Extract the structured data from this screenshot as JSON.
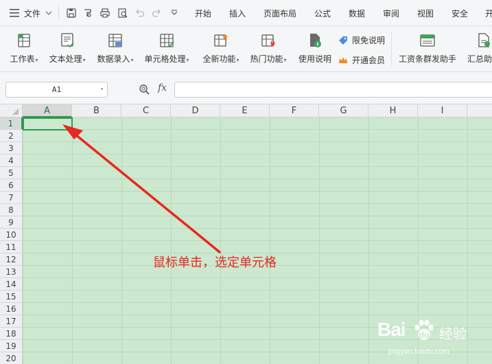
{
  "menubar": {
    "file_label": "文件",
    "tabs": [
      "开始",
      "插入",
      "页面布局",
      "公式",
      "数据",
      "审阅",
      "视图",
      "安全",
      "开"
    ]
  },
  "ribbon": {
    "items": [
      {
        "label": "工作表",
        "dropdown": true,
        "icon": "worksheet-icon"
      },
      {
        "label": "文本处理",
        "dropdown": true,
        "icon": "text-processing-icon"
      },
      {
        "label": "数据录入",
        "dropdown": true,
        "icon": "data-entry-icon"
      },
      {
        "label": "单元格处理",
        "dropdown": true,
        "icon": "cell-processing-icon"
      },
      {
        "label": "全新功能",
        "dropdown": true,
        "icon": "new-feature-icon"
      },
      {
        "label": "热门功能",
        "dropdown": true,
        "icon": "hot-feature-icon"
      },
      {
        "label": "使用说明",
        "dropdown": false,
        "icon": "usage-info-icon"
      }
    ],
    "small_items": [
      {
        "label": "限免说明",
        "icon": "tag-icon"
      },
      {
        "label": "开通会员",
        "icon": "crown-icon"
      }
    ],
    "right_items": [
      {
        "label": "工资条群发助手",
        "icon": "payroll-icon"
      },
      {
        "label": "汇总助手",
        "icon": "summary-icon"
      }
    ]
  },
  "formula_bar": {
    "name_box": "A1",
    "fx_label": "fx",
    "value": ""
  },
  "grid": {
    "columns": [
      "A",
      "B",
      "C",
      "D",
      "E",
      "F",
      "G",
      "H",
      "I",
      ""
    ],
    "rows": [
      "1",
      "2",
      "3",
      "4",
      "5",
      "6",
      "7",
      "8",
      "9",
      "10",
      "11",
      "12",
      "13",
      "14",
      "15",
      "16",
      "17",
      "18",
      "19",
      "20"
    ],
    "selected_cell": "A1"
  },
  "annotation": {
    "text": "鼠标单击，选定单元格",
    "color": "#e8271f"
  },
  "watermark": {
    "brand": "Bai",
    "jingyan": "经验",
    "url": "jingyan.baidu.com"
  },
  "colors": {
    "accent": "#2e9b4e",
    "cell_bg": "#cce8cf",
    "arrow": "#e8271f"
  }
}
